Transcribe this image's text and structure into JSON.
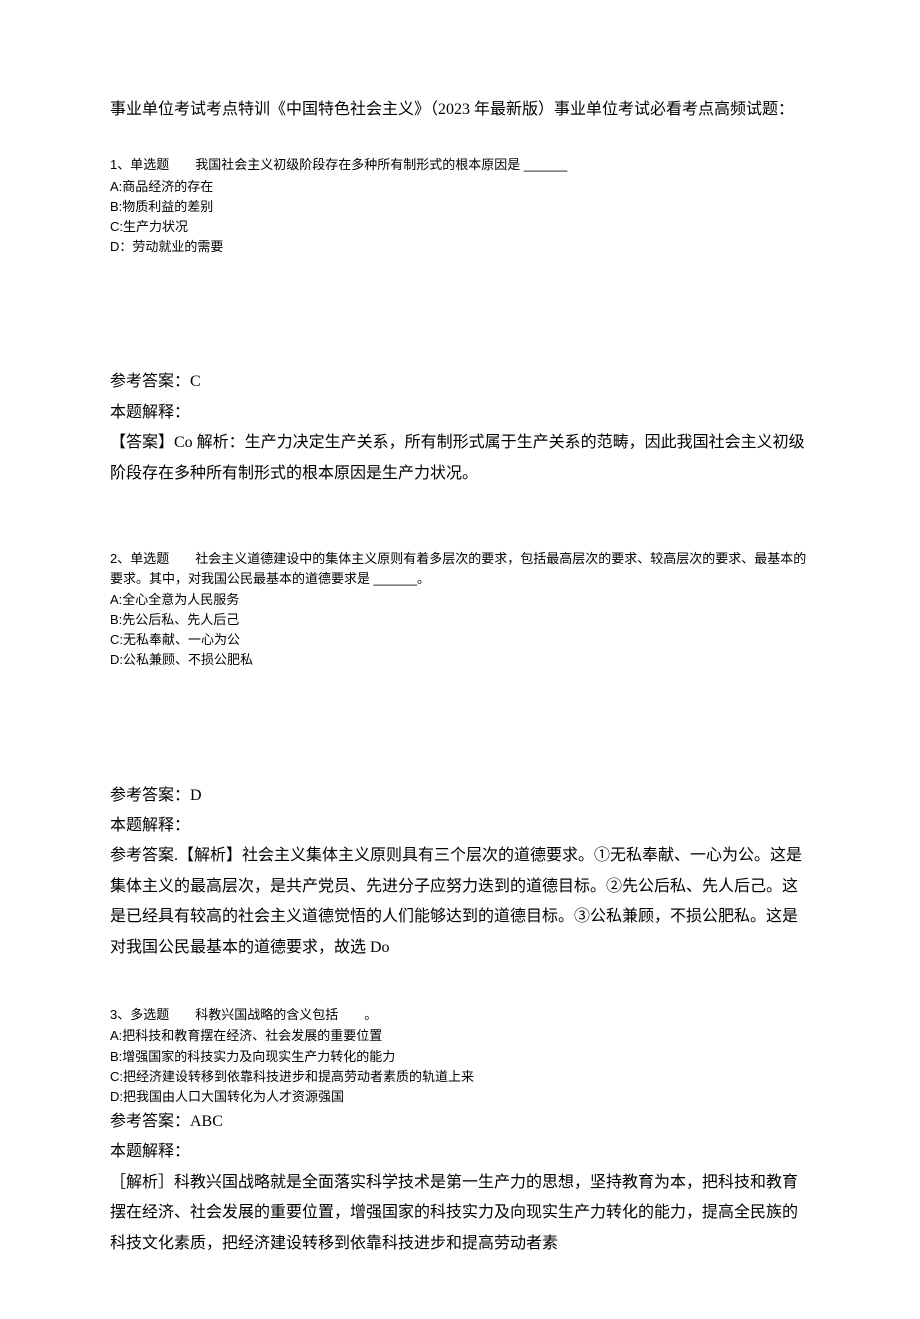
{
  "title": "事业单位考试考点特训《中国特色社会主义》（2023 年最新版）事业单位考试必看考点高频试题：",
  "q1": {
    "header": "1、单选题　　我国社会主义初级阶段存在多种所有制形式的根本原因是 ______",
    "optA": "A:商品经济的存在",
    "optB": "B:物质利益的差别",
    "optC": "C:生产力状况",
    "optD": "D：劳动就业的需要",
    "answerLabel": "参考答案：C",
    "explainLabel": "本题解释：",
    "explain": "【答案】Co 解析：生产力决定生产关系，所有制形式属于生产关系的范畴，因此我国社会主义初级阶段存在多种所有制形式的根本原因是生产力状况。"
  },
  "q2": {
    "header": "2、单选题　　社会主义道德建设中的集体主义原则有着多层次的要求，包括最高层次的要求、较高层次的要求、最基本的要求。其中，对我国公民最基本的道德要求是 ______。",
    "optA": "A:全心全意为人民服务",
    "optB": "B:先公后私、先人后己",
    "optC": "C:无私奉献、一心为公",
    "optD": "D:公私兼顾、不损公肥私",
    "answerLabel": "参考答案：D",
    "explainLabel": "本题解释：",
    "explain": "参考答案.【解析】社会主义集体主义原则具有三个层次的道德要求。①无私奉献、一心为公。这是集体主义的最高层次，是共产党员、先进分子应努力迭到的道德目标。②先公后私、先人后己。这是已经具有较高的社会主义道德觉悟的人们能够达到的道德目标。③公私兼顾，不损公肥私。这是对我国公民最基本的道德要求，故选 Do"
  },
  "q3": {
    "header": "3、多选题　　科教兴国战略的含义包括　　。",
    "optA": "A:把科技和教育摆在经济、社会发展的重要位置",
    "optB": "B:增强国家的科技实力及向现实生产力转化的能力",
    "optC": "C:把经济建设转移到依靠科技进步和提高劳动者素质的轨道上来",
    "optD": "D:把我国由人口大国转化为人才资源强国",
    "answerLabel": "参考答案：ABC",
    "explainLabel": "本题解释：",
    "explain": "［解析］科教兴国战略就是全面落实科学技术是第一生产力的思想，坚持教育为本，把科技和教育摆在经济、社会发展的重要位置，增强国家的科技实力及向现实生产力转化的能力，提高全民族的科技文化素质，把经济建设转移到依靠科技进步和提高劳动者素"
  }
}
